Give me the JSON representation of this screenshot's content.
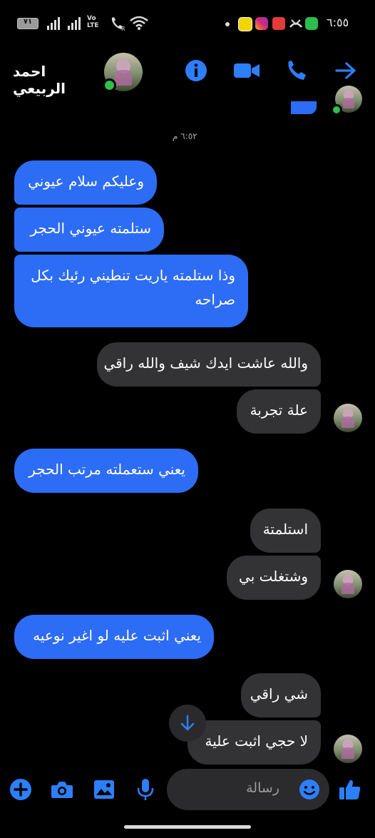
{
  "status": {
    "battery": "٧١",
    "signal_label": "Vo\nLTE",
    "time": "٦:٥٥"
  },
  "header": {
    "contact_name": "احمد الربيعي"
  },
  "conversation": {
    "timestamp": "٦:٥٢ م",
    "messages": [
      {
        "dir": "out",
        "text": "وعليكم سلام عيوني"
      },
      {
        "dir": "out",
        "text": "ستلمته عيوني الحجر"
      },
      {
        "dir": "out",
        "text": "وذا ستلمته ياريت تنطيني رئيك بكل صراحه"
      },
      {
        "dir": "in",
        "text": "والله عاشت ايدك شيف والله راقي"
      },
      {
        "dir": "in",
        "text": "علة تجربة"
      },
      {
        "dir": "out",
        "text": "يعني ستعملته مرتب الحجر"
      },
      {
        "dir": "in",
        "text": "استلمتة"
      },
      {
        "dir": "in",
        "text": "وشتغلت بي"
      },
      {
        "dir": "out",
        "text": "يعني اثبت عليه لو اغير نوعيه"
      },
      {
        "dir": "in",
        "text": "شي راقي"
      },
      {
        "dir": "in",
        "text": "لا حجي اثبت علية"
      }
    ]
  },
  "composer": {
    "placeholder": "رسالة"
  },
  "colors": {
    "accent": "#2d6cf5",
    "incoming_bubble": "#333335",
    "online": "#2fbf4a"
  }
}
